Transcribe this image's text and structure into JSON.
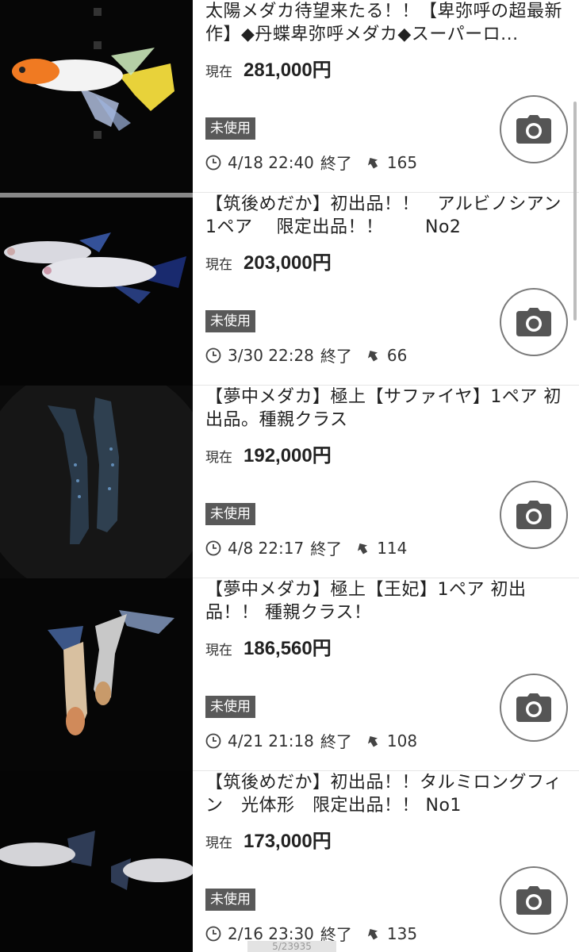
{
  "listings": [
    {
      "title": "太陽メダカ待望来たる！！【卑弥呼の超最新作】◆丹蝶卑弥呼メダカ◆スーパーロ...",
      "price_label": "現在",
      "price": "281,000円",
      "condition": "未使用",
      "end_time": "4/18 22:40",
      "end_label": "終了",
      "bids": "165",
      "thumb_icon": "orange-white-medaka-fish"
    },
    {
      "title": "【筑後めだか】初出品！！　アルビノシアン　　1ペア　 限定出品！！　　 No2",
      "price_label": "現在",
      "price": "203,000円",
      "condition": "未使用",
      "end_time": "3/30 22:28",
      "end_label": "終了",
      "bids": "66",
      "thumb_icon": "albino-cyan-medaka-pair"
    },
    {
      "title": "【夢中メダカ】極上【サファイヤ】1ペア 初出品。種親クラス",
      "price_label": "現在",
      "price": "192,000円",
      "condition": "未使用",
      "end_time": "4/8 22:17",
      "end_label": "終了",
      "bids": "114",
      "thumb_icon": "sapphire-medaka-pair"
    },
    {
      "title": "【夢中メダカ】極上【王妃】1ペア 初出品！！ 種親クラス！",
      "price_label": "現在",
      "price": "186,560円",
      "condition": "未使用",
      "end_time": "4/21 21:18",
      "end_label": "終了",
      "bids": "108",
      "thumb_icon": "ouhi-medaka-pair"
    },
    {
      "title": "【筑後めだか】初出品！！タルミロングフィン　光体形　限定出品！！ No1",
      "price_label": "現在",
      "price": "173,000円",
      "condition": "未使用",
      "end_time": "2/16 23:30",
      "end_label": "終了",
      "bids": "135",
      "thumb_icon": "longfin-medaka-pair"
    }
  ],
  "icons": {
    "clock": "clock-icon",
    "gavel": "gavel-icon",
    "camera": "camera-icon"
  },
  "footer_text": "5/23935",
  "colors": {
    "badge_bg": "#595959",
    "thumb_bg": "#050505",
    "camera_border": "#7a7a7a"
  }
}
